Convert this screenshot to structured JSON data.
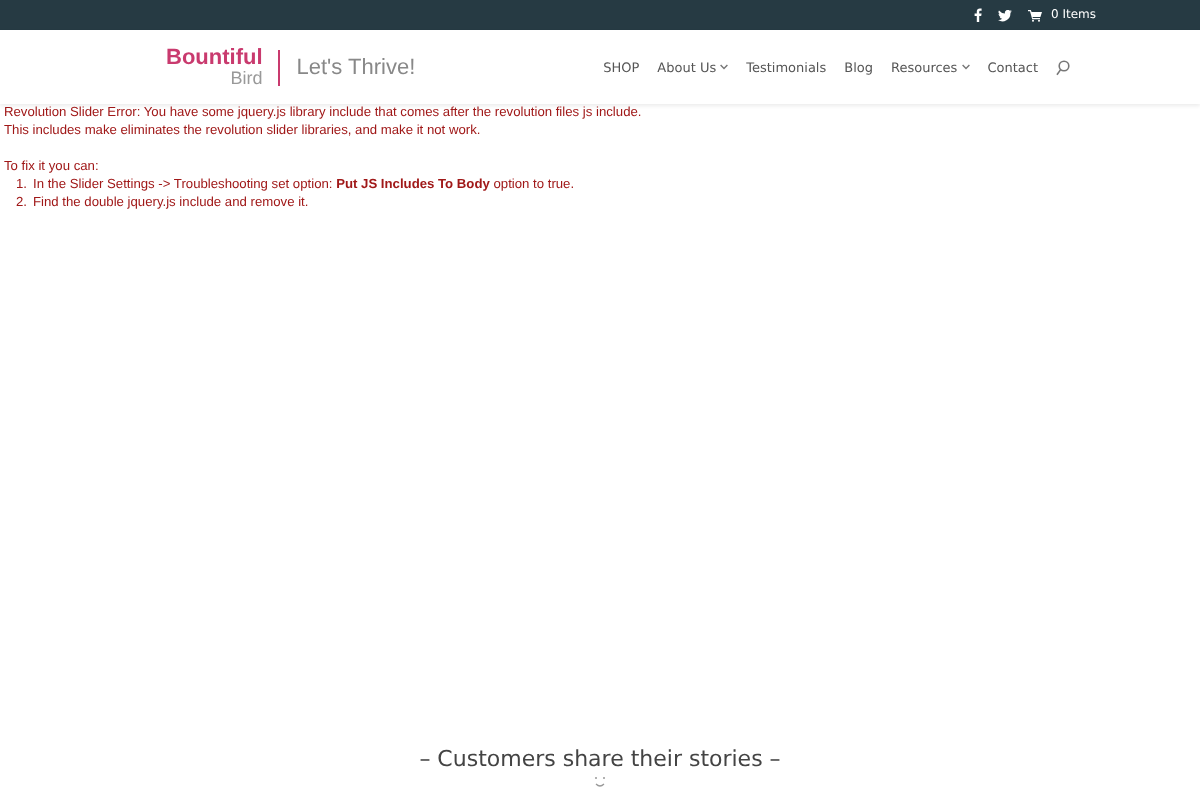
{
  "top_bar": {
    "cart": "0 Items"
  },
  "header": {
    "logo_main": "Bountiful",
    "logo_sub": "Bird",
    "tagline": "Let's Thrive!"
  },
  "nav": [
    {
      "label": "SHOP",
      "dropdown": false
    },
    {
      "label": "About Us",
      "dropdown": true
    },
    {
      "label": "Testimonials",
      "dropdown": false
    },
    {
      "label": "Blog",
      "dropdown": false
    },
    {
      "label": "Resources",
      "dropdown": true
    },
    {
      "label": "Contact",
      "dropdown": false
    }
  ],
  "error": {
    "lines": [
      "Revolution Slider Error: You have some jquery.js library include that comes after the revolution files js include.",
      "This includes make eliminates the revolution slider libraries, and make it not work."
    ],
    "fix_intro": "To fix it you can:",
    "steps": [
      {
        "marker": "1.",
        "text": "In the Slider Settings -> Troubleshooting set option: **Put JS Includes To Body** option to true."
      },
      {
        "marker": "2.",
        "text": "Find the double jquery.js include and remove it."
      }
    ]
  },
  "testimonials": {
    "heading": "– Customers share their stories –"
  }
}
